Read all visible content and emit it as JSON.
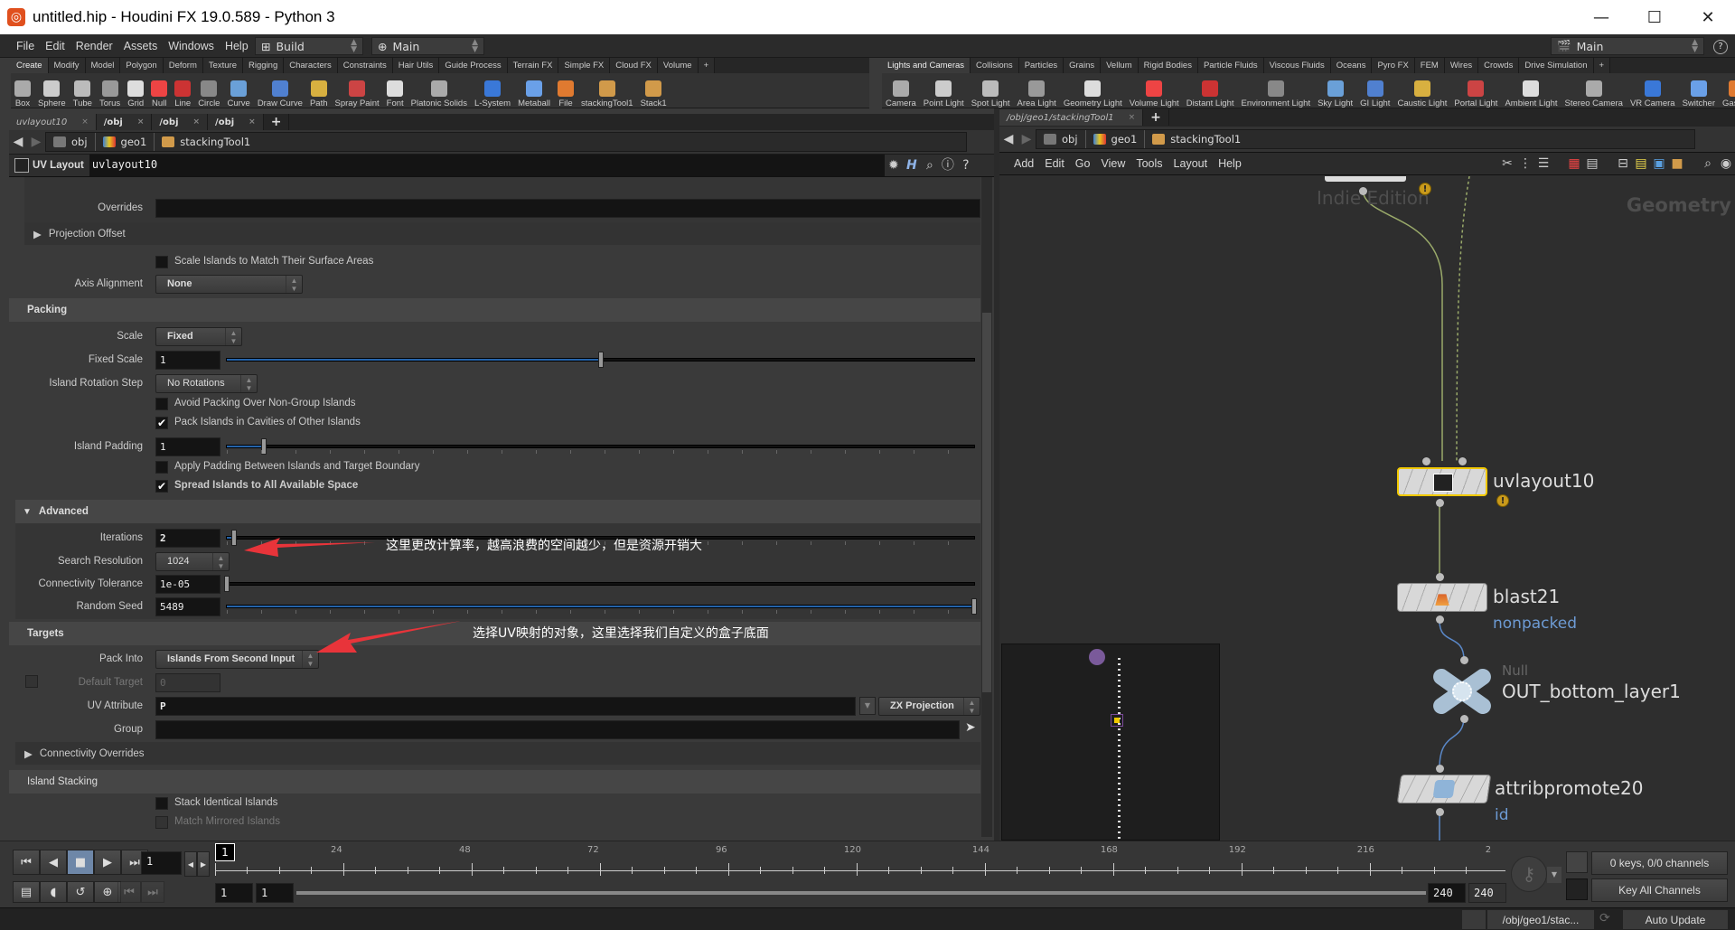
{
  "window": {
    "title": "untitled.hip - Houdini FX 19.0.589 - Python 3",
    "controls": {
      "minimize": "—",
      "maximize": "☐",
      "close": "✕"
    }
  },
  "menubar": {
    "items": [
      "File",
      "Edit",
      "Render",
      "Assets",
      "Windows",
      "Help"
    ],
    "desktop": "Build",
    "context": "Main",
    "right_desktop": "Main",
    "help_icon": "?"
  },
  "shelf_left": {
    "tabs": [
      "Create",
      "Modify",
      "Model",
      "Polygon",
      "Deform",
      "Texture",
      "Rigging",
      "Characters",
      "Constraints",
      "Hair Utils",
      "Guide Process",
      "Terrain FX",
      "Simple FX",
      "Cloud FX",
      "Volume"
    ],
    "active_tab": "Create",
    "tools": [
      "Box",
      "Sphere",
      "Tube",
      "Torus",
      "Grid",
      "Null",
      "Line",
      "Circle",
      "Curve",
      "Draw Curve",
      "Path",
      "Spray Paint",
      "Font",
      "Platonic Solids",
      "L-System",
      "Metaball",
      "File",
      "stackingTool1",
      "Stack1"
    ]
  },
  "shelf_right": {
    "tabs": [
      "Lights and Cameras",
      "Collisions",
      "Particles",
      "Grains",
      "Vellum",
      "Rigid Bodies",
      "Particle Fluids",
      "Viscous Fluids",
      "Oceans",
      "Pyro FX",
      "FEM",
      "Wires",
      "Crowds",
      "Drive Simulation"
    ],
    "active_tab": "Lights and Cameras",
    "tools": [
      "Camera",
      "Point Light",
      "Spot Light",
      "Area Light",
      "Geometry Light",
      "Volume Light",
      "Distant Light",
      "Environment Light",
      "Sky Light",
      "GI Light",
      "Caustic Light",
      "Portal Light",
      "Ambient Light",
      "Stereo Camera",
      "VR Camera",
      "Switcher",
      "Gas Ca"
    ]
  },
  "left_pane": {
    "tabs": [
      "uvlayout10",
      "/obj",
      "/obj",
      "/obj"
    ],
    "path": [
      "obj",
      "geo1",
      "stackingTool1"
    ],
    "node_type": "UV Layout",
    "node_name": "uvlayout10",
    "params": {
      "overrides_label": "Overrides",
      "projection_offset": "Projection Offset",
      "scale_islands": "Scale Islands to Match Their Surface Areas",
      "axis_alignment_label": "Axis Alignment",
      "axis_alignment_value": "None",
      "packing_section": "Packing",
      "scale_label": "Scale",
      "scale_value": "Fixed",
      "fixed_scale_label": "Fixed Scale",
      "fixed_scale_value": "1",
      "fixed_scale_slider": 0.5,
      "rotation_step_label": "Island Rotation Step",
      "rotation_step_value": "No Rotations",
      "avoid_packing": "Avoid Packing Over Non-Group Islands",
      "avoid_packing_checked": false,
      "pack_cavities": "Pack Islands in Cavities of Other Islands",
      "pack_cavities_checked": true,
      "island_padding_label": "Island Padding",
      "island_padding_value": "1",
      "island_padding_slider": 0.05,
      "apply_padding": "Apply Padding Between Islands and Target Boundary",
      "apply_padding_checked": false,
      "spread_islands": "Spread Islands to All Available Space",
      "spread_islands_checked": true,
      "advanced_section": "Advanced",
      "iterations_label": "Iterations",
      "iterations_value": "2",
      "iterations_slider": 0.01,
      "search_res_label": "Search Resolution",
      "search_res_value": "1024",
      "conn_tol_label": "Connectivity Tolerance",
      "conn_tol_value": "1e-05",
      "conn_tol_slider": 0.0,
      "random_seed_label": "Random Seed",
      "random_seed_value": "5489",
      "random_seed_slider": 1.0,
      "targets_section": "Targets",
      "pack_into_label": "Pack Into",
      "pack_into_value": "Islands From Second Input",
      "default_target_label": "Default Target",
      "default_target_value": "0",
      "uv_attr_label": "UV Attribute",
      "uv_attr_value": "P",
      "projection_value": "ZX Projection",
      "group_label": "Group",
      "group_value": "",
      "connectivity_overrides": "Connectivity Overrides",
      "island_stacking_section": "Island Stacking",
      "stack_identical": "Stack Identical Islands",
      "match_mirrored": "Match Mirrored Islands"
    },
    "annotations": {
      "search_res_note": "这里更改计算率，越高浪费的空间越少，但是资源开销大",
      "pack_into_note": "选择UV映射的对象，这里选择我们自定义的盒子底面"
    }
  },
  "right_pane": {
    "tab": "/obj/geo1/stackingTool1",
    "path": [
      "obj",
      "geo1",
      "stackingTool1"
    ],
    "menu": [
      "Add",
      "Edit",
      "Go",
      "View",
      "Tools",
      "Layout",
      "Help"
    ],
    "watermark": "Indie Edition",
    "context_label": "Geometry",
    "nodes": [
      {
        "name": "uvlayout10",
        "sub": "",
        "selected": true,
        "warning": true
      },
      {
        "name": "blast21",
        "sub": "nonpacked"
      },
      {
        "name": "OUT_bottom_layer1",
        "type_label": "Null"
      },
      {
        "name": "attribpromote20",
        "sub": "id"
      }
    ]
  },
  "timeline": {
    "current_frame": "1",
    "frame_marker": "1",
    "ticks": [
      "24",
      "48",
      "72",
      "96",
      "120",
      "144",
      "168",
      "192",
      "216",
      "2"
    ],
    "start": "1",
    "start2": "1",
    "end": "240",
    "end2": "240",
    "keys_status": "0 keys, 0/0 channels",
    "key_mode": "Key All Channels"
  },
  "statusbar": {
    "path": "/obj/geo1/stac...",
    "update_mode": "Auto Update"
  }
}
